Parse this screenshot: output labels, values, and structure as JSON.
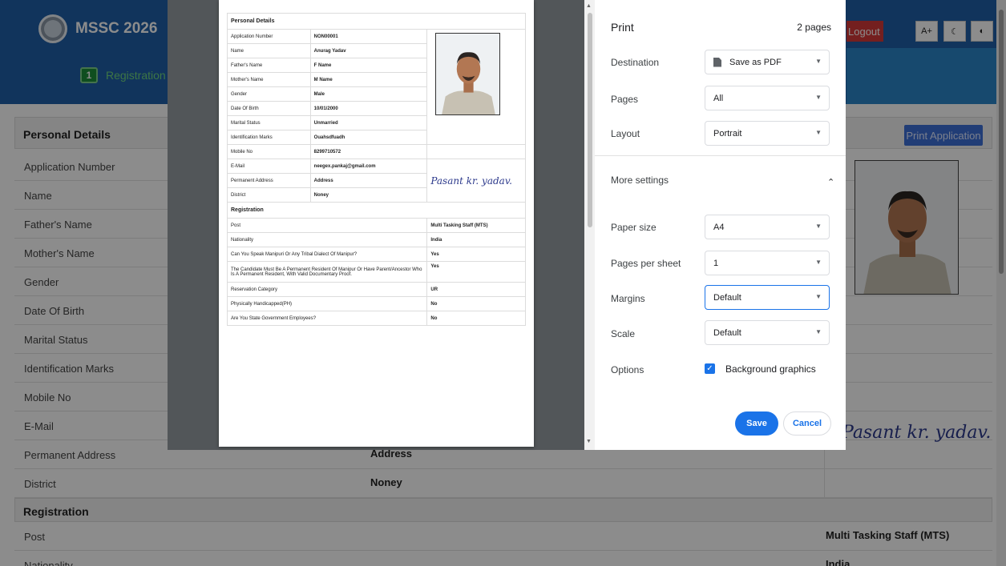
{
  "app": {
    "brand": "MSSC 2026",
    "step": {
      "number": "1",
      "label": "Registration"
    },
    "logout_label": "Logout",
    "font_increase_label": "A+"
  },
  "page": {
    "section_personal": "Personal Details",
    "print_application_label": "Print Application",
    "rows": [
      {
        "label": "Application Number",
        "value": ""
      },
      {
        "label": "Name",
        "value": ""
      },
      {
        "label": "Father's Name",
        "value": ""
      },
      {
        "label": "Mother's Name",
        "value": ""
      },
      {
        "label": "Gender",
        "value": ""
      },
      {
        "label": "Date Of Birth",
        "value": ""
      },
      {
        "label": "Marital Status",
        "value": ""
      },
      {
        "label": "Identification Marks",
        "value": ""
      },
      {
        "label": "Mobile No",
        "value": ""
      },
      {
        "label": "E-Mail",
        "value": ""
      },
      {
        "label": "Permanent Address",
        "value": "Address"
      },
      {
        "label": "District",
        "value": "Noney"
      }
    ],
    "section_registration": "Registration",
    "post_label": "Post",
    "post_value": "Multi Tasking Staff (MTS)",
    "nationality_label": "Nationality",
    "nationality_value": "India",
    "signature_text": "Pasant kr. yadav."
  },
  "print_preview": {
    "section_personal": "Personal Details",
    "personal": [
      {
        "label": "Application Number",
        "value": "NON00001"
      },
      {
        "label": "Name",
        "value": "Anurag Yadav"
      },
      {
        "label": "Father's Name",
        "value": "F Name"
      },
      {
        "label": "Mother's Name",
        "value": "M Name"
      },
      {
        "label": "Gender",
        "value": "Male"
      },
      {
        "label": "Date Of Birth",
        "value": "10/01/2000"
      },
      {
        "label": "Marital Status",
        "value": "Unmarried"
      },
      {
        "label": "Identification Marks",
        "value": "Ouahsdfuadh"
      },
      {
        "label": "Mobile No",
        "value": "8299710572"
      },
      {
        "label": "E-Mail",
        "value": "neegex.pankaj@gmail.com"
      },
      {
        "label": "Permanent Address",
        "value": "Address"
      },
      {
        "label": "District",
        "value": "Noney"
      }
    ],
    "section_registration": "Registration",
    "registration": [
      {
        "label": "Post",
        "value": "Multi Tasking Staff (MTS)"
      },
      {
        "label": "Nationality",
        "value": "India"
      },
      {
        "label": "Can You Speak Manipuri Or Any Tribal Dialect Of Manipur?",
        "value": "Yes"
      },
      {
        "label": "The Candidate Must Be A Permanent Resident Of Manipur Or Have Parent/Ancestor Who Is A Permanent Resident, With Valid Documentary Proof.",
        "value": "Yes"
      },
      {
        "label": "Reservation Category",
        "value": "UR"
      },
      {
        "label": "Physically Handicapped(PH)",
        "value": "No"
      },
      {
        "label": "Are You State Government Employees?",
        "value": "No"
      }
    ],
    "signature_text": "Pasant kr. yadav."
  },
  "print_dialog": {
    "title": "Print",
    "page_count": "2 pages",
    "destination_label": "Destination",
    "destination_value": "Save as PDF",
    "pages_label": "Pages",
    "pages_value": "All",
    "layout_label": "Layout",
    "layout_value": "Portrait",
    "more_settings_label": "More settings",
    "paper_size_label": "Paper size",
    "paper_size_value": "A4",
    "pages_per_sheet_label": "Pages per sheet",
    "pages_per_sheet_value": "1",
    "margins_label": "Margins",
    "margins_value": "Default",
    "scale_label": "Scale",
    "scale_value": "Default",
    "options_label": "Options",
    "background_graphics_label": "Background graphics",
    "background_graphics_checked": true,
    "save_label": "Save",
    "cancel_label": "Cancel"
  },
  "colors": {
    "header": "#1f5fa8",
    "accent": "#1a73e8",
    "logout": "#d43a3a"
  }
}
